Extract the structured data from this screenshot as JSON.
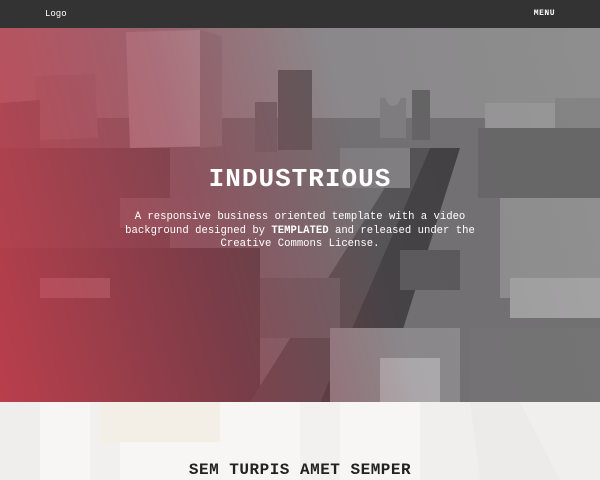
{
  "header": {
    "logo": "Logo",
    "menu": "MENU"
  },
  "hero": {
    "title": "INDUSTRIOUS",
    "description_pre": "A responsive business oriented template with a video background designed by ",
    "description_brand": "TEMPLATED",
    "description_post": " and released under the Creative Commons License."
  },
  "section": {
    "title": "SEM TURPIS AMET SEMPER"
  },
  "colors": {
    "header_bg": "#333333",
    "accent": "#ce3c4c",
    "section_bg": "#f7f6f5"
  }
}
